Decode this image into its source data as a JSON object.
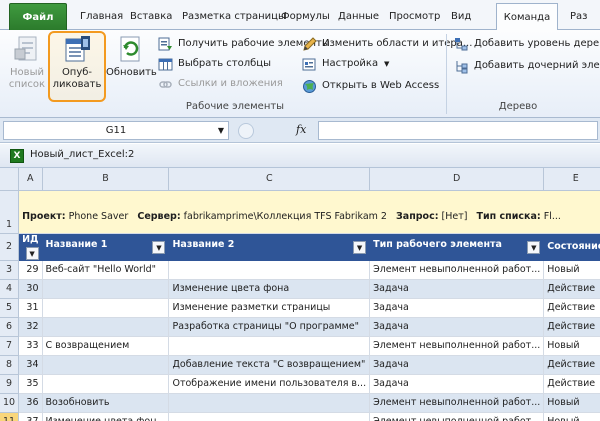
{
  "tabs": {
    "file": "Файл",
    "items": [
      "Главная",
      "Вставка",
      "Разметка страницы",
      "Формулы",
      "Данные",
      "Просмотр",
      "Вид"
    ],
    "active": "Команда",
    "overflow": "Раз"
  },
  "ribbon": {
    "work_items": {
      "group_label": "Рабочие элементы",
      "new_list": "Новый\nсписок",
      "publish": "Опуб-\nликовать",
      "refresh": "Обновить",
      "get_work_items": "Получить рабочие элементы",
      "choose_columns": "Выбрать столбцы",
      "links_attachments": "Ссылки и вложения",
      "edit_areas": "Изменить области и итера...",
      "configure": "Настройка",
      "open_web_access": "Открыть в Web Access"
    },
    "tree": {
      "group_label": "Дерево",
      "add_tree_level": "Добавить уровень дерева",
      "add_child": "Добавить дочерний элемент"
    }
  },
  "formula_bar": {
    "name_box": "G11",
    "fx": "fx",
    "value": ""
  },
  "workbook": {
    "icon_letter": "X",
    "title": "Новый_лист_Excel:2"
  },
  "grid": {
    "col_headers": [
      "A",
      "B",
      "C",
      "D",
      "E"
    ],
    "info_row": {
      "row_num": "1",
      "parts": [
        {
          "label": "Проект:",
          "value": "Phone Saver"
        },
        {
          "label": "Сервер:",
          "value": "fabrikamprime\\Коллекция TFS Fabrikam 2"
        },
        {
          "label": "Запрос:",
          "value": "[Нет]"
        },
        {
          "label": "Тип списка:",
          "value": "Fl..."
        }
      ]
    },
    "header_row": {
      "row_num": "2",
      "cells": [
        "ИД",
        "Название 1",
        "Название 2",
        "Тип рабочего элемента",
        "Состояние"
      ]
    },
    "rows": [
      {
        "row_num": "3",
        "id": "29",
        "title1": "Веб-сайт \"Hello World\"",
        "title2": "",
        "type": "Элемент невыполненной работ...",
        "state": "Новый"
      },
      {
        "row_num": "4",
        "id": "30",
        "title1": "",
        "title2": "Изменение цвета фона",
        "type": "Задача",
        "state": "Действие"
      },
      {
        "row_num": "5",
        "id": "31",
        "title1": "",
        "title2": "Изменение разметки страницы",
        "type": "Задача",
        "state": "Действие"
      },
      {
        "row_num": "6",
        "id": "32",
        "title1": "",
        "title2": "Разработка страницы \"О программе\"",
        "type": "Задача",
        "state": "Действие"
      },
      {
        "row_num": "7",
        "id": "33",
        "title1": "С возвращением",
        "title2": "",
        "type": "Элемент невыполненной работ...",
        "state": "Новый"
      },
      {
        "row_num": "8",
        "id": "34",
        "title1": "",
        "title2": "Добавление текста \"С возвращением\"",
        "type": "Задача",
        "state": "Действие"
      },
      {
        "row_num": "9",
        "id": "35",
        "title1": "",
        "title2": "Отображение имени пользователя в...",
        "type": "Задача",
        "state": "Действие"
      },
      {
        "row_num": "10",
        "id": "36",
        "title1": "Возобновить",
        "title2": "",
        "type": "Элемент невыполненной работ...",
        "state": "Новый"
      },
      {
        "row_num": "11",
        "id": "37",
        "title1": "Изменение цвета фон...",
        "title2": "",
        "type": "Элемент невыполненной работ...",
        "state": "Новый"
      }
    ],
    "selected_row": "11"
  },
  "colors": {
    "file_tab": "#2c7b2c",
    "header_fill": "#2f5597",
    "band_fill": "#dbe5f1",
    "info_fill": "#fff8cf",
    "publish_highlight": "#f39a1f"
  },
  "icons": {
    "new_list": "new-list-icon",
    "publish": "publish-icon",
    "refresh": "refresh-icon",
    "get_work_items": "get-work-items-icon",
    "choose_columns": "choose-columns-icon",
    "links": "links-icon",
    "edit_areas": "pencil-icon",
    "configure": "configure-icon",
    "web_access": "globe-icon",
    "add_tree_level": "add-tree-level-icon",
    "add_child": "add-child-icon"
  }
}
